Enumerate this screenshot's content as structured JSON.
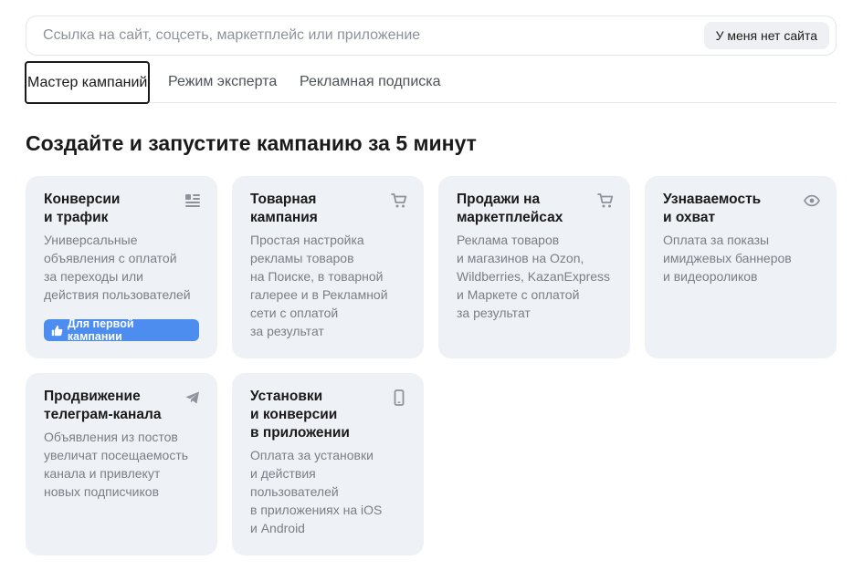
{
  "search": {
    "placeholder": "Ссылка на сайт, соцсеть, маркетплейс или приложение",
    "value": "",
    "no_site_label": "У меня нет сайта"
  },
  "tabs": [
    {
      "label": "Мастер кампаний",
      "active": true
    },
    {
      "label": "Режим эксперта",
      "active": false
    },
    {
      "label": "Рекламная подписка",
      "active": false
    }
  ],
  "page_title": "Создайте и запустите кампанию за 5 минут",
  "cards": [
    {
      "title": "Конверсии\nи трафик",
      "description": "Универсальные\nобъявления с оплатой\nза переходы или\nдействия пользователей",
      "icon": "list-icon",
      "badge": "Для первой кампании"
    },
    {
      "title": "Товарная\nкампания",
      "description": "Простая настройка\nрекламы товаров\nна Поиске, в товарной\nгалерее и в Рекламной\nсети с оплатой\nза результат",
      "icon": "cart-icon"
    },
    {
      "title": "Продажи на\nмаркетплейсах",
      "description": "Реклама товаров\nи магазинов на Ozon,\nWildberries, KazanExpress\nи Маркете с оплатой\nза результат",
      "icon": "cart-icon"
    },
    {
      "title": "Узнаваемость\nи охват",
      "description": "Оплата за показы\nимиджевых баннеров\nи видеороликов",
      "icon": "eye-icon"
    },
    {
      "title": "Продвижение\nтелеграм-канала",
      "description": "Объявления из постов\nувеличат посещаемость\nканала и привлекут\nновых подписчиков",
      "icon": "telegram-icon"
    },
    {
      "title": "Установки\nи конверсии\nв приложении",
      "description": "Оплата за установки\nи действия\nпользователей\nв приложениях на iOS\nи Android",
      "icon": "phone-icon"
    }
  ],
  "colors": {
    "card_bg": "#eef1f5",
    "badge_bg": "#4d8df0",
    "muted_text": "#7a7f87",
    "icon": "#8e939b"
  }
}
